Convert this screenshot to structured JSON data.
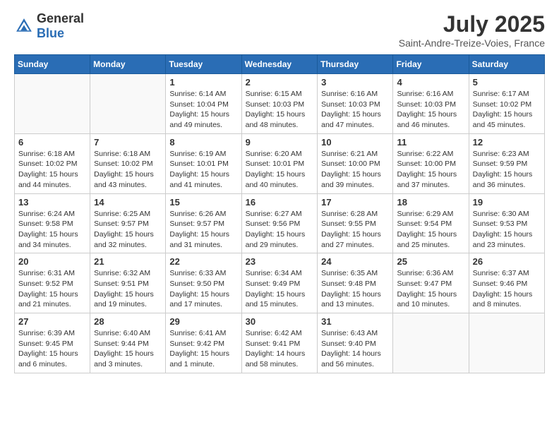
{
  "header": {
    "logo_general": "General",
    "logo_blue": "Blue",
    "month_title": "July 2025",
    "location": "Saint-Andre-Treize-Voies, France"
  },
  "weekdays": [
    "Sunday",
    "Monday",
    "Tuesday",
    "Wednesday",
    "Thursday",
    "Friday",
    "Saturday"
  ],
  "weeks": [
    [
      {
        "day": "",
        "info": ""
      },
      {
        "day": "",
        "info": ""
      },
      {
        "day": "1",
        "info": "Sunrise: 6:14 AM\nSunset: 10:04 PM\nDaylight: 15 hours and 49 minutes."
      },
      {
        "day": "2",
        "info": "Sunrise: 6:15 AM\nSunset: 10:03 PM\nDaylight: 15 hours and 48 minutes."
      },
      {
        "day": "3",
        "info": "Sunrise: 6:16 AM\nSunset: 10:03 PM\nDaylight: 15 hours and 47 minutes."
      },
      {
        "day": "4",
        "info": "Sunrise: 6:16 AM\nSunset: 10:03 PM\nDaylight: 15 hours and 46 minutes."
      },
      {
        "day": "5",
        "info": "Sunrise: 6:17 AM\nSunset: 10:02 PM\nDaylight: 15 hours and 45 minutes."
      }
    ],
    [
      {
        "day": "6",
        "info": "Sunrise: 6:18 AM\nSunset: 10:02 PM\nDaylight: 15 hours and 44 minutes."
      },
      {
        "day": "7",
        "info": "Sunrise: 6:18 AM\nSunset: 10:02 PM\nDaylight: 15 hours and 43 minutes."
      },
      {
        "day": "8",
        "info": "Sunrise: 6:19 AM\nSunset: 10:01 PM\nDaylight: 15 hours and 41 minutes."
      },
      {
        "day": "9",
        "info": "Sunrise: 6:20 AM\nSunset: 10:01 PM\nDaylight: 15 hours and 40 minutes."
      },
      {
        "day": "10",
        "info": "Sunrise: 6:21 AM\nSunset: 10:00 PM\nDaylight: 15 hours and 39 minutes."
      },
      {
        "day": "11",
        "info": "Sunrise: 6:22 AM\nSunset: 10:00 PM\nDaylight: 15 hours and 37 minutes."
      },
      {
        "day": "12",
        "info": "Sunrise: 6:23 AM\nSunset: 9:59 PM\nDaylight: 15 hours and 36 minutes."
      }
    ],
    [
      {
        "day": "13",
        "info": "Sunrise: 6:24 AM\nSunset: 9:58 PM\nDaylight: 15 hours and 34 minutes."
      },
      {
        "day": "14",
        "info": "Sunrise: 6:25 AM\nSunset: 9:57 PM\nDaylight: 15 hours and 32 minutes."
      },
      {
        "day": "15",
        "info": "Sunrise: 6:26 AM\nSunset: 9:57 PM\nDaylight: 15 hours and 31 minutes."
      },
      {
        "day": "16",
        "info": "Sunrise: 6:27 AM\nSunset: 9:56 PM\nDaylight: 15 hours and 29 minutes."
      },
      {
        "day": "17",
        "info": "Sunrise: 6:28 AM\nSunset: 9:55 PM\nDaylight: 15 hours and 27 minutes."
      },
      {
        "day": "18",
        "info": "Sunrise: 6:29 AM\nSunset: 9:54 PM\nDaylight: 15 hours and 25 minutes."
      },
      {
        "day": "19",
        "info": "Sunrise: 6:30 AM\nSunset: 9:53 PM\nDaylight: 15 hours and 23 minutes."
      }
    ],
    [
      {
        "day": "20",
        "info": "Sunrise: 6:31 AM\nSunset: 9:52 PM\nDaylight: 15 hours and 21 minutes."
      },
      {
        "day": "21",
        "info": "Sunrise: 6:32 AM\nSunset: 9:51 PM\nDaylight: 15 hours and 19 minutes."
      },
      {
        "day": "22",
        "info": "Sunrise: 6:33 AM\nSunset: 9:50 PM\nDaylight: 15 hours and 17 minutes."
      },
      {
        "day": "23",
        "info": "Sunrise: 6:34 AM\nSunset: 9:49 PM\nDaylight: 15 hours and 15 minutes."
      },
      {
        "day": "24",
        "info": "Sunrise: 6:35 AM\nSunset: 9:48 PM\nDaylight: 15 hours and 13 minutes."
      },
      {
        "day": "25",
        "info": "Sunrise: 6:36 AM\nSunset: 9:47 PM\nDaylight: 15 hours and 10 minutes."
      },
      {
        "day": "26",
        "info": "Sunrise: 6:37 AM\nSunset: 9:46 PM\nDaylight: 15 hours and 8 minutes."
      }
    ],
    [
      {
        "day": "27",
        "info": "Sunrise: 6:39 AM\nSunset: 9:45 PM\nDaylight: 15 hours and 6 minutes."
      },
      {
        "day": "28",
        "info": "Sunrise: 6:40 AM\nSunset: 9:44 PM\nDaylight: 15 hours and 3 minutes."
      },
      {
        "day": "29",
        "info": "Sunrise: 6:41 AM\nSunset: 9:42 PM\nDaylight: 15 hours and 1 minute."
      },
      {
        "day": "30",
        "info": "Sunrise: 6:42 AM\nSunset: 9:41 PM\nDaylight: 14 hours and 58 minutes."
      },
      {
        "day": "31",
        "info": "Sunrise: 6:43 AM\nSunset: 9:40 PM\nDaylight: 14 hours and 56 minutes."
      },
      {
        "day": "",
        "info": ""
      },
      {
        "day": "",
        "info": ""
      }
    ]
  ]
}
